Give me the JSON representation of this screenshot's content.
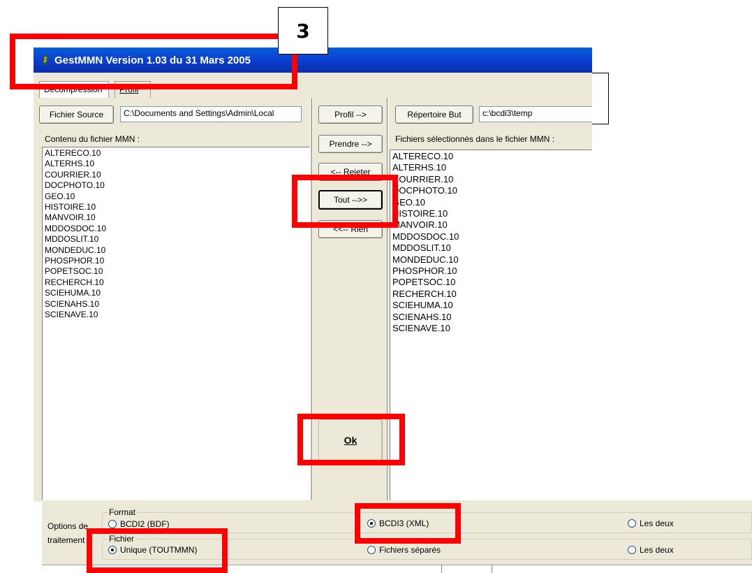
{
  "window": {
    "title": "GestMMN  Version 1.03 du 31 Mars 2005",
    "icon": "app-icon"
  },
  "tabs": [
    {
      "label": "Décompression"
    },
    {
      "label": "Profil"
    }
  ],
  "left": {
    "source_button": "Fichier Source",
    "source_path": "C:\\Documents and Settings\\Admin\\Local",
    "list_label": "Contenu du fichier MMN :",
    "items": [
      "ALTERECO.10",
      "ALTERHS.10",
      "COURRIER.10",
      "DOCPHOTO.10",
      "GEO.10",
      "HISTOIRE.10",
      "MANVOIR.10",
      "MDDOSDOC.10",
      "MDDOSLIT.10",
      "MONDEDUC.10",
      "PHOSPHOR.10",
      "POPETSOC.10",
      "RECHERCH.10",
      "SCIEHUMA.10",
      "SCIENAHS.10",
      "SCIENAVE.10"
    ]
  },
  "middle": {
    "profil_button": "Profil -->",
    "prendre_button": "Prendre -->",
    "rejeter_button": "<-- Rejeter",
    "tout_button": "Tout -->>",
    "rien_button": "<<-- Rien",
    "ok_button": "Ok"
  },
  "right": {
    "dest_button": "Répertoire But",
    "dest_path": "c:\\bcdi3\\temp",
    "list_label": "Fichiers sélectionnés dans le fichier MMN :",
    "items": [
      "ALTERECO.10",
      "ALTERHS.10",
      "COURRIER.10",
      "DOCPHOTO.10",
      "GEO.10",
      "HISTOIRE.10",
      "MANVOIR.10",
      "MDDOSDOC.10",
      "MDDOSLIT.10",
      "MONDEDUC.10",
      "PHOSPHOR.10",
      "POPETSOC.10",
      "RECHERCH.10",
      "SCIEHUMA.10",
      "SCIENAHS.10",
      "SCIENAVE.10"
    ]
  },
  "options": {
    "label_line1": "Options de",
    "label_line2": "traitement",
    "format_legend": "Format",
    "format_options": [
      {
        "label": "BCDI2 (BDF)",
        "selected": false
      },
      {
        "label": "BCDI3 (XML)",
        "selected": true
      },
      {
        "label": "Les deux",
        "selected": false
      }
    ],
    "fichier_legend": "Fichier",
    "fichier_options": [
      {
        "label": "Unique (TOUTMMN)",
        "selected": true
      },
      {
        "label": "Fichiers séparés",
        "selected": false
      },
      {
        "label": "Les deux",
        "selected": false
      }
    ]
  },
  "annotation": {
    "step_number": "3",
    "highlight_color": "#ff0000"
  }
}
